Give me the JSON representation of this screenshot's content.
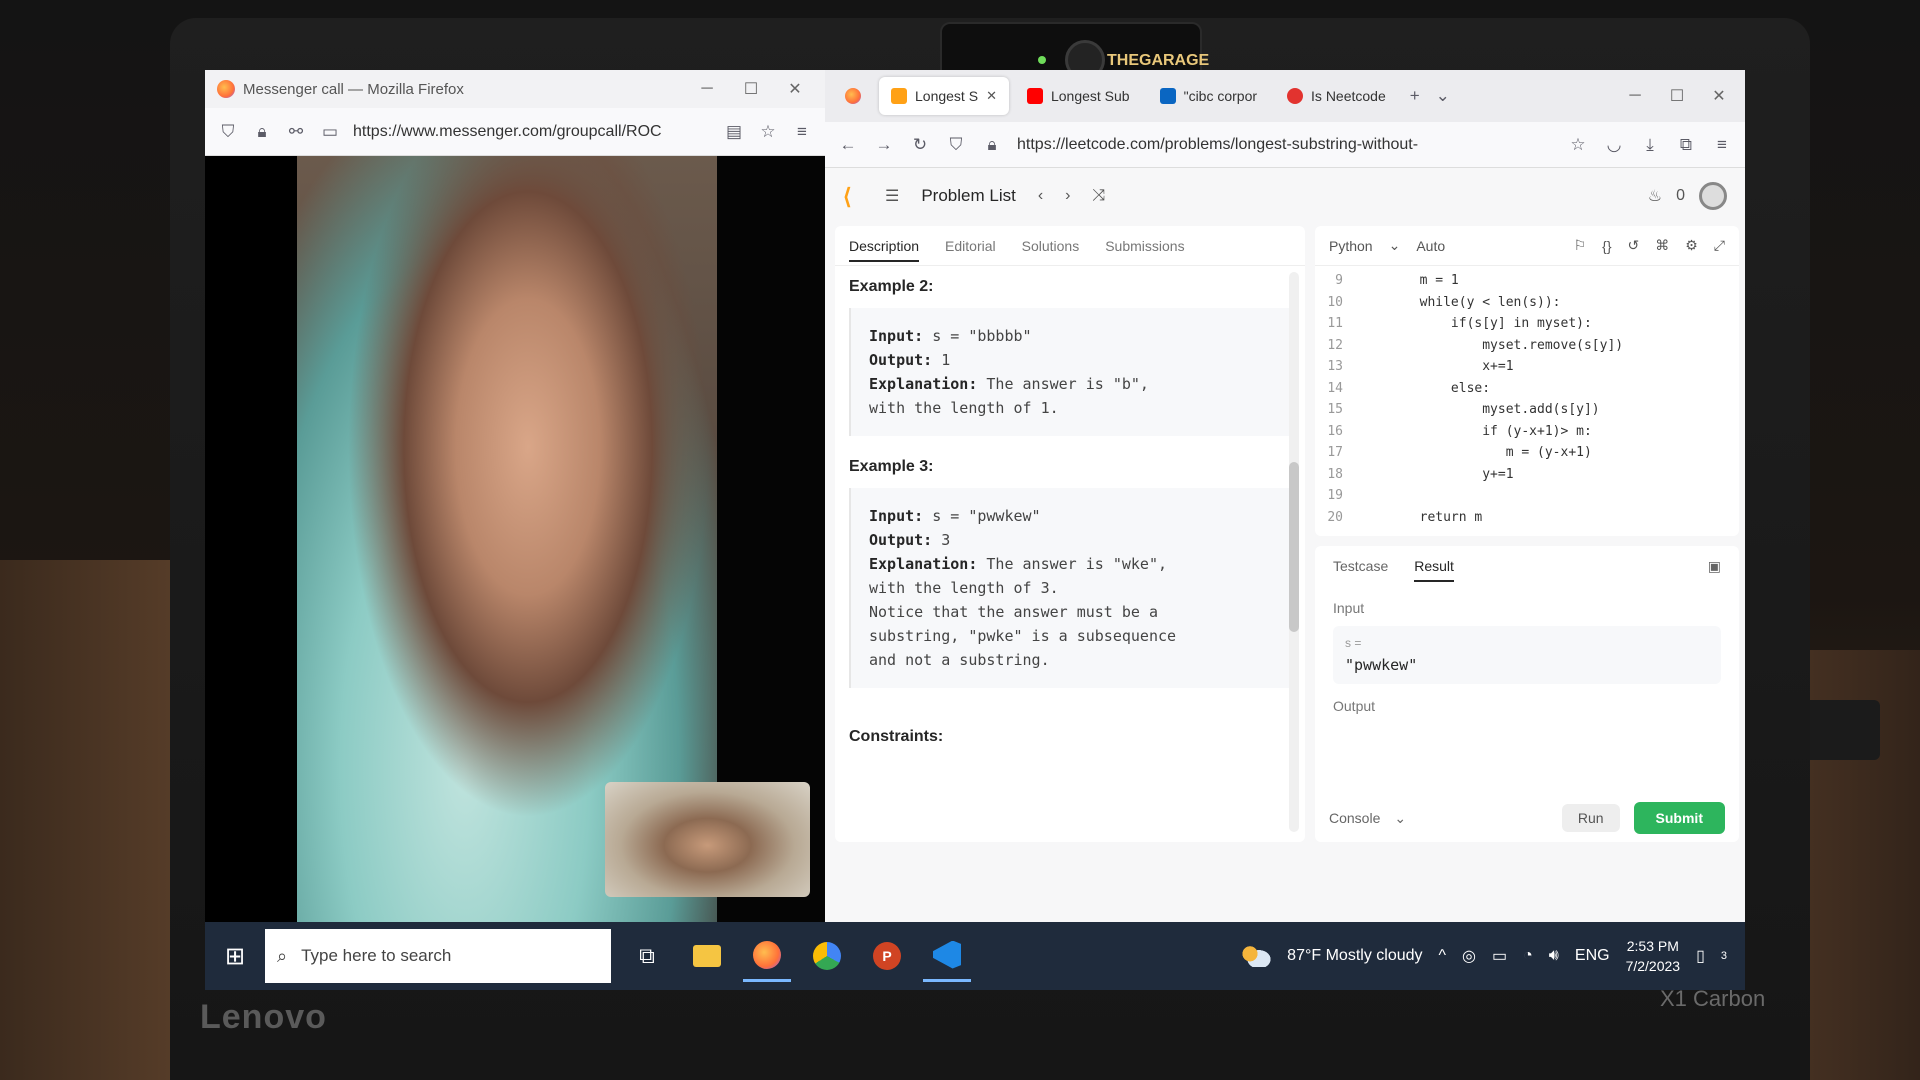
{
  "hardware": {
    "webcam_label": "THEGARAGE",
    "brand": "Lenovo",
    "model": "X1 Carbon"
  },
  "messenger_window": {
    "title": "Messenger call — Mozilla Firefox",
    "url": "https://www.messenger.com/groupcall/ROC"
  },
  "leetcode_window": {
    "tabs": [
      {
        "label": "",
        "icon": "firefox-icon"
      },
      {
        "label": "Longest S",
        "icon": "leetcode-icon",
        "active": true
      },
      {
        "label": "Longest Sub",
        "icon": "youtube-icon"
      },
      {
        "label": "\"cibc corpor",
        "icon": "linkedin-icon"
      },
      {
        "label": "Is Neetcode",
        "icon": "neetcode-icon"
      }
    ],
    "url": "https://leetcode.com/problems/longest-substring-without-",
    "nav": {
      "problem_list": "Problem List",
      "streak_count": "0"
    },
    "description_tabs": [
      "Description",
      "Editorial",
      "Solutions",
      "Submissions"
    ],
    "examples": [
      {
        "title": "Example 2:",
        "lines": [
          {
            "label": "Input:",
            "text": " s = \"bbbbb\""
          },
          {
            "label": "Output:",
            "text": " 1"
          },
          {
            "label": "Explanation:",
            "text": " The answer is \"b\","
          },
          {
            "label": "",
            "text": "with the length of 1."
          }
        ]
      },
      {
        "title": "Example 3:",
        "lines": [
          {
            "label": "Input:",
            "text": " s = \"pwwkew\""
          },
          {
            "label": "Output:",
            "text": " 3"
          },
          {
            "label": "Explanation:",
            "text": " The answer is \"wke\","
          },
          {
            "label": "",
            "text": "with the length of 3."
          },
          {
            "label": "",
            "text": "Notice that the answer must be a"
          },
          {
            "label": "",
            "text": "substring, \"pwke\" is a subsequence"
          },
          {
            "label": "",
            "text": "and not a substring."
          }
        ]
      }
    ],
    "constraints_title": "Constraints:",
    "editor": {
      "language": "Python",
      "mode": "Auto",
      "lines": [
        {
          "n": "9",
          "code": "        m = 1"
        },
        {
          "n": "10",
          "code": "        while(y < len(s)):"
        },
        {
          "n": "11",
          "code": "            if(s[y] in myset):"
        },
        {
          "n": "12",
          "code": "                myset.remove(s[y])"
        },
        {
          "n": "13",
          "code": "                x+=1"
        },
        {
          "n": "14",
          "code": "            else:"
        },
        {
          "n": "15",
          "code": "                myset.add(s[y])"
        },
        {
          "n": "16",
          "code": "                if (y-x+1)> m:"
        },
        {
          "n": "17",
          "code": "                   m = (y-x+1)"
        },
        {
          "n": "18",
          "code": "                y+=1"
        },
        {
          "n": "19",
          "code": ""
        },
        {
          "n": "20",
          "code": "        return m"
        }
      ]
    },
    "result": {
      "tabs": [
        "Testcase",
        "Result"
      ],
      "input_label": "Input",
      "var_name": "s =",
      "input_value": "\"pwwkew\"",
      "output_label": "Output",
      "console": "Console",
      "run": "Run",
      "submit": "Submit"
    }
  },
  "taskbar": {
    "search_placeholder": "Type here to search",
    "weather": "87°F  Mostly cloudy",
    "language": "ENG",
    "time": "2:53 PM",
    "date": "7/2/2023",
    "notifications": "3"
  },
  "colors": {
    "accent_green": "#2db55d",
    "leetcode_orange": "#ffa116",
    "taskbar": "#1f2b3c"
  }
}
